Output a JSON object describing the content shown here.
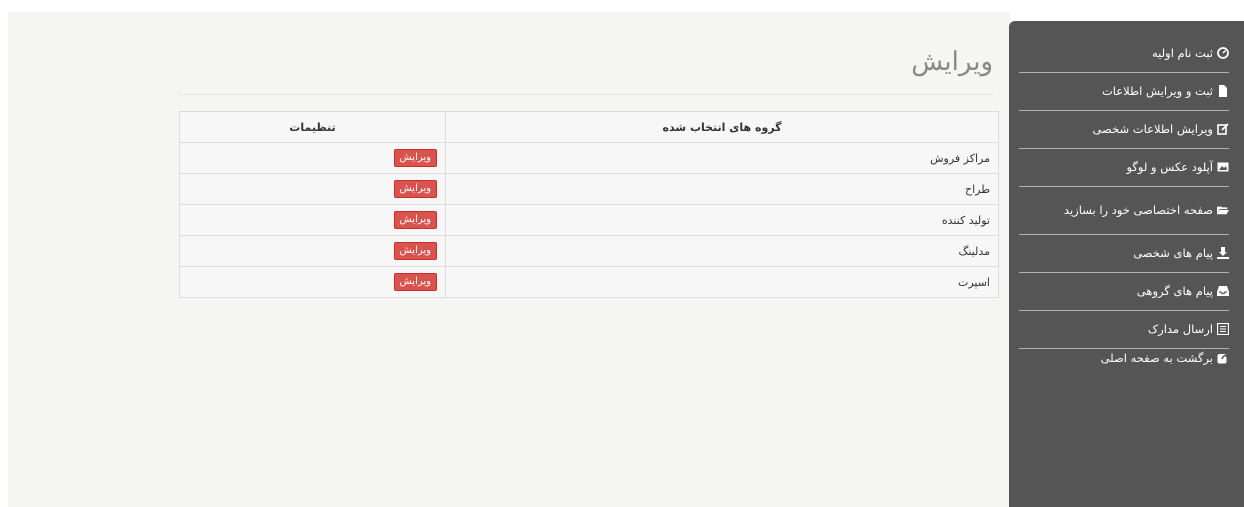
{
  "page": {
    "title": "ویرایش"
  },
  "sidebar": {
    "items": [
      {
        "label": "ثبت نام اولیه",
        "icon": "dashboard-icon"
      },
      {
        "label": "ثبت و ویرایش اطلاعات",
        "icon": "file-icon"
      },
      {
        "label": "ویرایش اطلاعات شخصی",
        "icon": "edit-icon"
      },
      {
        "label": "آپلود عکس و لوگو",
        "icon": "picture-icon"
      },
      {
        "label": "صفحه اختصاصی خود را بسازید",
        "icon": "folder-open-icon"
      },
      {
        "label": "پیام های شخصی",
        "icon": "download-icon"
      },
      {
        "label": "پیام های گروهی",
        "icon": "inbox-icon"
      },
      {
        "label": "ارسال مدارک",
        "icon": "list-alt-icon"
      },
      {
        "label": "برگشت به صفحه اصلی",
        "icon": "share-icon"
      }
    ]
  },
  "table": {
    "headers": {
      "groups": "گروه های انتخاب شده",
      "settings": "تنظیمات"
    },
    "rows": [
      {
        "name": "مراکز فروش",
        "action": "ویرایش"
      },
      {
        "name": "طراح",
        "action": "ویرایش"
      },
      {
        "name": "تولید کننده",
        "action": "ویرایش"
      },
      {
        "name": "مدلینگ",
        "action": "ویرایش"
      },
      {
        "name": "اسپرت",
        "action": "ویرایش"
      }
    ]
  }
}
